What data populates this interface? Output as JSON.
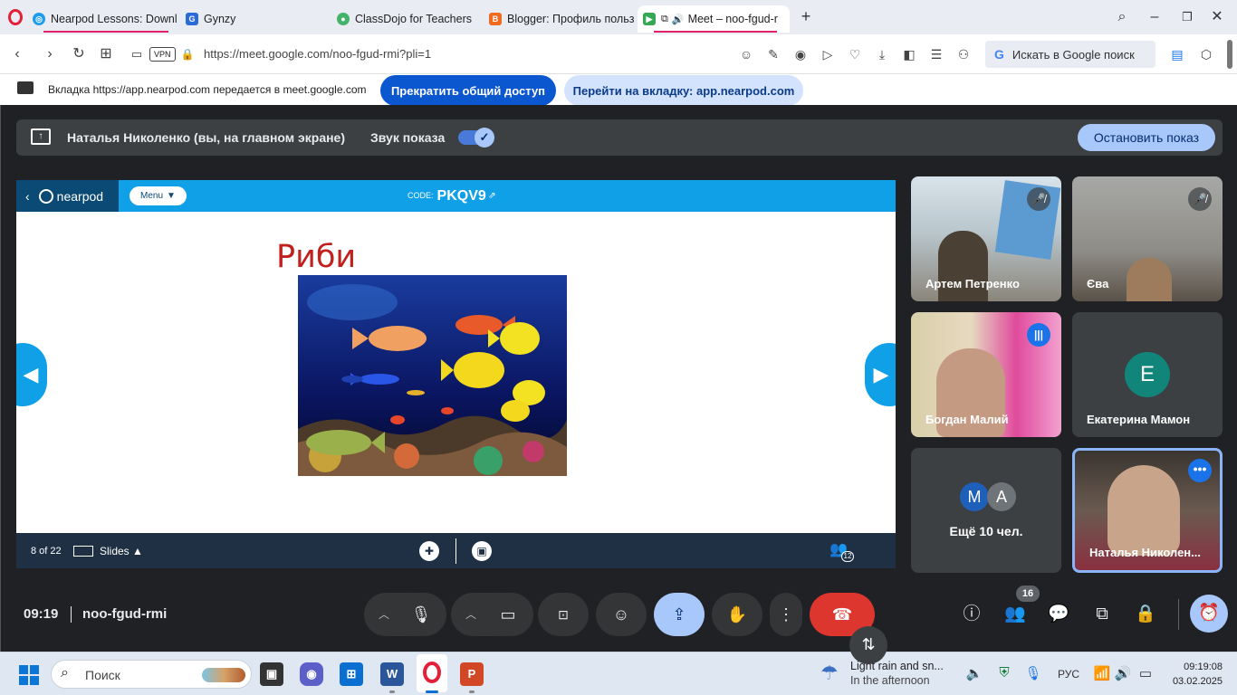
{
  "browser": {
    "tabs": [
      {
        "label": "Nearpod Lessons: Downlo",
        "color": "#1e9bea"
      },
      {
        "label": "Gynzy",
        "color": "#2a6bd8"
      },
      {
        "label": "ClassDojo for Teachers",
        "color": "#45b46a"
      },
      {
        "label": "Blogger: Профиль пользо",
        "color": "#f06a1f"
      },
      {
        "label": "Meet – noo-fgud-r",
        "color": "#34a853"
      }
    ],
    "url": "https://meet.google.com/noo-fgud-rmi?pli=1",
    "vpn": "VPN",
    "search_placeholder": "Искать в Google поиск",
    "share_notice": "Вкладка https://app.nearpod.com передается в meet.google.com",
    "stop_sharing": "Прекратить общий доступ",
    "switch_tab": "Перейти на вкладку: app.nearpod.com"
  },
  "meet": {
    "presenter": "Наталья Николенко (вы, на главном экране)",
    "sound_label": "Звук показа",
    "sound_on": true,
    "stop_presenting": "Остановить показ",
    "time": "09:19",
    "meeting_code": "noo-fgud-rmi",
    "participant_count": "16",
    "participants": [
      {
        "name": "Артем Петренко",
        "muted": true
      },
      {
        "name": "Єва",
        "muted": true
      },
      {
        "name": "Богдан Малий",
        "speaking": true
      },
      {
        "name": "Екатерина Мамон",
        "initial": "E",
        "color": "#12857a"
      },
      {
        "name": "Ещё 10 чел.",
        "initials": [
          "M",
          "A"
        ]
      },
      {
        "name": "Наталья Николен..."
      }
    ]
  },
  "nearpod": {
    "logo": "nearpod",
    "menu": "Menu",
    "code_label": "CODE:",
    "code": "PKQV9",
    "slide_title": "Риби",
    "page": "8 of 22",
    "slides_label": "Slides",
    "student_count": "12"
  },
  "taskbar": {
    "search": "Поиск",
    "weather_title": "Light rain and sn...",
    "weather_sub": "In the afternoon",
    "lang": "РУС",
    "clock_time": "09:19:08",
    "clock_date": "03.02.2025"
  }
}
